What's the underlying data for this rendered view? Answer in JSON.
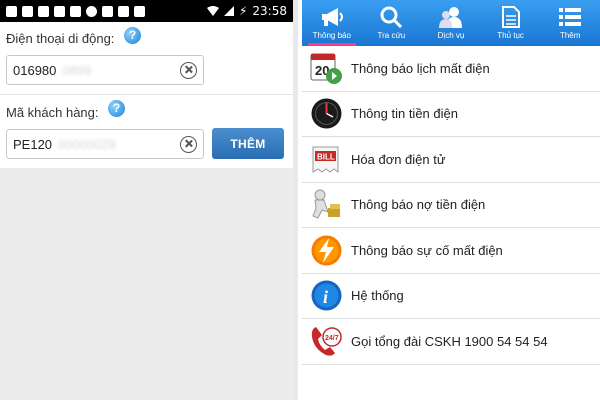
{
  "status_bar": {
    "time": "23:58",
    "battery_glyph": "⚡",
    "icons": [
      "sim-icon",
      "facebook-icon",
      "mail-icon",
      "chat-icon",
      "chat-icon",
      "usb-icon",
      "chat-icon",
      "message-icon",
      "image-icon",
      "wifi-icon",
      "signal-icon",
      "battery-icon"
    ]
  },
  "form": {
    "phone": {
      "label": "Điện thoại di động:",
      "help": "?",
      "value": "016980",
      "value_blurred": "0899"
    },
    "customer": {
      "label": "Mã khách hàng:",
      "help": "?",
      "value": "PE120",
      "value_blurred": "00000029"
    },
    "add_button": "THÊM"
  },
  "tabs": [
    {
      "label": "Thông báo",
      "icon": "megaphone-icon",
      "active": true
    },
    {
      "label": "Tra cứu",
      "icon": "search-icon",
      "active": false
    },
    {
      "label": "Dịch vụ",
      "icon": "people-icon",
      "active": false
    },
    {
      "label": "Thủ tục",
      "icon": "document-icon",
      "active": false
    },
    {
      "label": "Thêm",
      "icon": "list-icon",
      "active": false
    }
  ],
  "menu": [
    {
      "label": "Thông báo lịch mất điện",
      "icon": "calendar-icon"
    },
    {
      "label": "Thông tin tiền điện",
      "icon": "meter-icon"
    },
    {
      "label": "Hóa đơn điện tử",
      "icon": "bill-icon"
    },
    {
      "label": "Thông báo nợ tiền điện",
      "icon": "debt-icon"
    },
    {
      "label": "Thông báo sự cố mất điện",
      "icon": "lightning-icon"
    },
    {
      "label": "Hệ thống",
      "icon": "info-icon"
    },
    {
      "label": "Gọi tổng đài CSKH 1900 54 54 54",
      "icon": "phone-24-7-icon"
    }
  ],
  "icon_texts": {
    "calendar": "20",
    "bill": "BILL",
    "info": "i",
    "hotline": "24/7"
  },
  "colors": {
    "tabbar": "#1976d2",
    "active_tab_underline": "#ff3b7f",
    "button": "#2a6cb1"
  }
}
